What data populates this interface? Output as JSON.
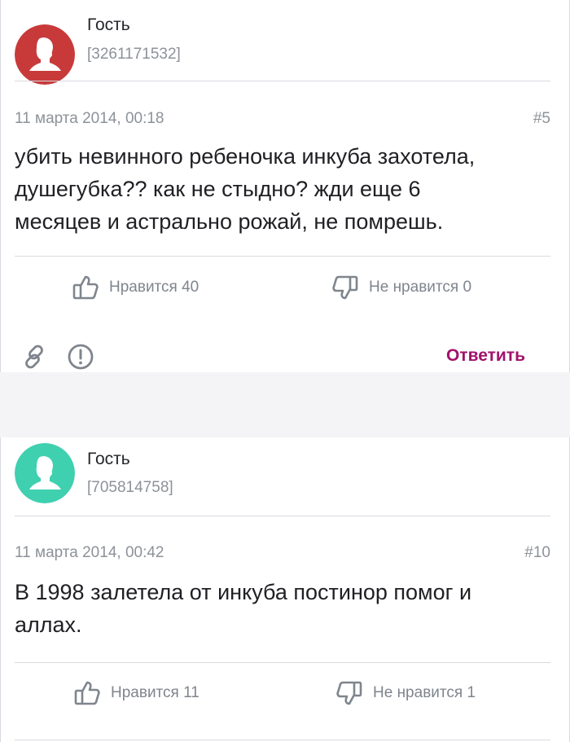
{
  "colors": {
    "avatar_red": "#c83a3a",
    "avatar_teal": "#3fd0b0",
    "reply_accent": "#a0126b",
    "icon_gray": "#7f858d"
  },
  "posts": [
    {
      "author": {
        "name": "Гость",
        "id": "[3261171532]",
        "avatar_icon": "person-silhouette-icon",
        "avatar_color": "#c83a3a"
      },
      "date": "11 марта 2014, 00:18",
      "number": "#5",
      "text_lines": [
        "убить невинного ребеночка инкуба захотела,",
        "душегубка?? как не стыдно? жди еще 6",
        "месяцев и астрально рожай, не помрешь."
      ],
      "likes": {
        "label": "Нравится 40",
        "icon": "thumb-up-icon"
      },
      "dislikes": {
        "label": "Не нравится 0",
        "icon": "thumb-down-icon"
      },
      "actions": {
        "link_icon": "link-icon",
        "report_icon": "exclamation-icon",
        "reply_label": "Ответить"
      }
    },
    {
      "author": {
        "name": "Гость",
        "id": "[705814758]",
        "avatar_icon": "person-silhouette-icon",
        "avatar_color": "#3fd0b0"
      },
      "date": "11 марта 2014, 00:42",
      "number": "#10",
      "text_lines": [
        "В 1998 залетела от инкуба постинор помог и",
        "аллах."
      ],
      "likes": {
        "label": "Нравится 11",
        "icon": "thumb-up-icon"
      },
      "dislikes": {
        "label": "Не нравится 1",
        "icon": "thumb-down-icon"
      }
    }
  ]
}
